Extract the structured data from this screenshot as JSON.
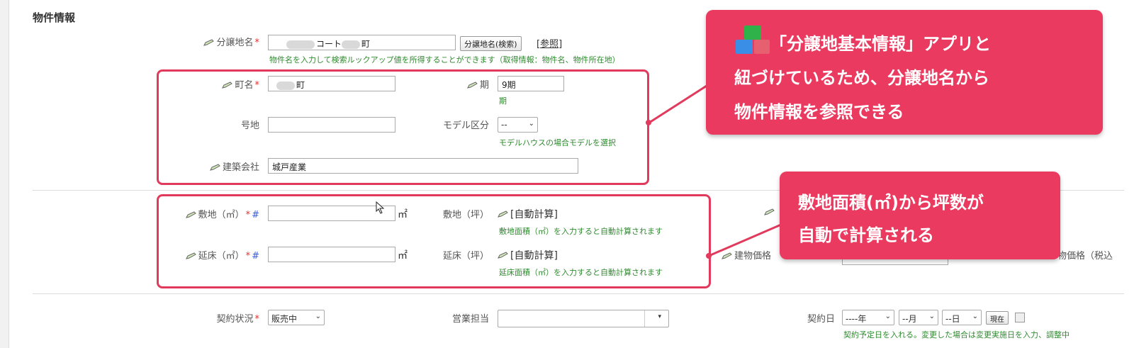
{
  "section": {
    "title": "物件情報"
  },
  "fields": {
    "bunjo": {
      "label": "分譲地名",
      "value_suffix": "コート",
      "value_tail": "町",
      "search_button": "分譲地名(検索)",
      "ref_link": "[参照]",
      "hint": "物件名を入力して検索ルックアップ値を所得することができます（取得情報：物件名、物件所在地）"
    },
    "cho": {
      "label": "町名",
      "value": "町"
    },
    "ki": {
      "label": "期",
      "value": "9期",
      "hint": "期"
    },
    "gochi": {
      "label": "号地",
      "value": ""
    },
    "model": {
      "label": "モデル区分",
      "value": "--",
      "hint": "モデルハウスの場合モデルを選択"
    },
    "kenchiku": {
      "label": "建築会社",
      "value": "城戸産業"
    },
    "shikichi": {
      "label": "敷地（㎡）",
      "unit": "㎡",
      "tsubo_label": "敷地（坪）",
      "auto": "[自動計算]",
      "hint": "敷地面積（㎡）を入力すると自動計算されます"
    },
    "nobeyuka": {
      "label": "延床（㎡）",
      "unit": "㎡",
      "tsubo_label": "延床（坪）",
      "auto": "[自動計算]",
      "hint": "延床面積（㎡）を入力すると自動計算されます"
    },
    "tatemono": {
      "label": "建物価格",
      "right_label": "物価格（税込"
    },
    "keiyaku_status": {
      "label": "契約状況",
      "value": "販売中"
    },
    "eigyo": {
      "label": "営業担当",
      "value": ""
    },
    "keiyaku_date": {
      "label": "契約日",
      "year": "----年",
      "month": "--月",
      "day": "--日",
      "now_button": "現在",
      "hint": "契約予定日を入れる。変更した場合は変更実施日を入力、調整中"
    }
  },
  "markers": {
    "required": "*",
    "hash": "#"
  },
  "callouts": {
    "one": {
      "line1": "「分譲地基本情報」アプリと",
      "line2": "紐づけているため、分譲地名から",
      "line3": "物件情報を参照できる"
    },
    "two": {
      "line1": "敷地面積(㎡)から坪数が",
      "line2": "自動で計算される"
    }
  },
  "colors": {
    "accent": "#e23a5c",
    "callout_bg": "#ea3a5f",
    "hint_green": "#2f8a2f"
  },
  "icons": {
    "pen": "pencil-icon",
    "apps": "app-blocks-icon"
  }
}
